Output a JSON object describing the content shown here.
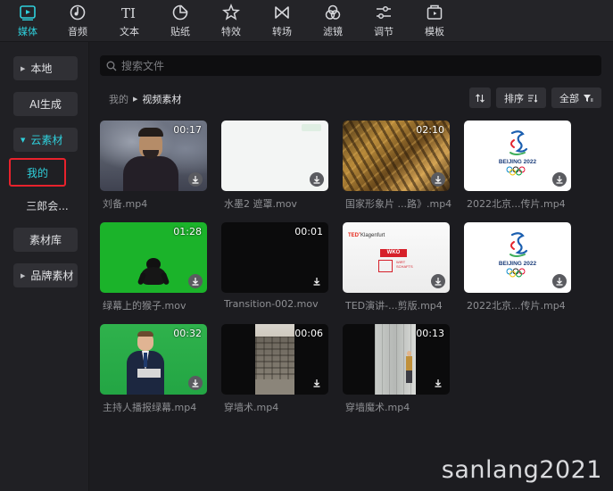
{
  "toolbar": {
    "tools": [
      {
        "label": "媒体",
        "icon": "media-icon",
        "active": true
      },
      {
        "label": "音频",
        "icon": "audio-icon"
      },
      {
        "label": "文本",
        "icon": "text-icon"
      },
      {
        "label": "贴纸",
        "icon": "sticker-icon"
      },
      {
        "label": "特效",
        "icon": "effects-icon"
      },
      {
        "label": "转场",
        "icon": "transition-icon"
      },
      {
        "label": "滤镜",
        "icon": "filter-icon"
      },
      {
        "label": "调节",
        "icon": "adjust-icon"
      },
      {
        "label": "模板",
        "icon": "template-icon"
      }
    ],
    "text_glyph": "TI"
  },
  "sidebar": {
    "local": "本地",
    "ai": "AI生成",
    "cloud": "云素材",
    "mine": "我的",
    "sanlang": "三郎会...",
    "library": "素材库",
    "brand": "品牌素材"
  },
  "search": {
    "placeholder": "搜索文件"
  },
  "breadcrumb": {
    "root": "我的",
    "current": "视频素材"
  },
  "controls": {
    "sort_label": "排序",
    "all_label": "全部"
  },
  "accent_color": "#2fd0dc",
  "highlight_color": "#e8222c",
  "media": [
    {
      "name": "刘备.mp4",
      "duration": "00:17"
    },
    {
      "name": "水墨2 遮罩.mov",
      "duration": ""
    },
    {
      "name": "国家形象片 ...路》.mp4",
      "duration": "02:10"
    },
    {
      "name": "2022北京...传片.mp4",
      "duration": ""
    },
    {
      "name": "绿幕上的猴子.mov",
      "duration": "01:28"
    },
    {
      "name": "Transition-002.mov",
      "duration": "00:01"
    },
    {
      "name": "TED演讲-...剪版.mp4",
      "duration": ""
    },
    {
      "name": "2022北京...传片.mp4",
      "duration": ""
    },
    {
      "name": "主持人播报绿幕.mp4",
      "duration": "00:32"
    },
    {
      "name": "穿墙术.mp4",
      "duration": "00:06"
    },
    {
      "name": "穿墙魔术.mp4",
      "duration": "00:13"
    }
  ],
  "thumb_text": {
    "olympic_caption": "BEIJING 2022",
    "ted_logo": "TED",
    "ted_place": "Klagenfurt",
    "ted_brand": "WKO",
    "ted_sub1": "WIRT",
    "ted_sub2": "SCHAFTS"
  },
  "watermark": "sanlang2021"
}
